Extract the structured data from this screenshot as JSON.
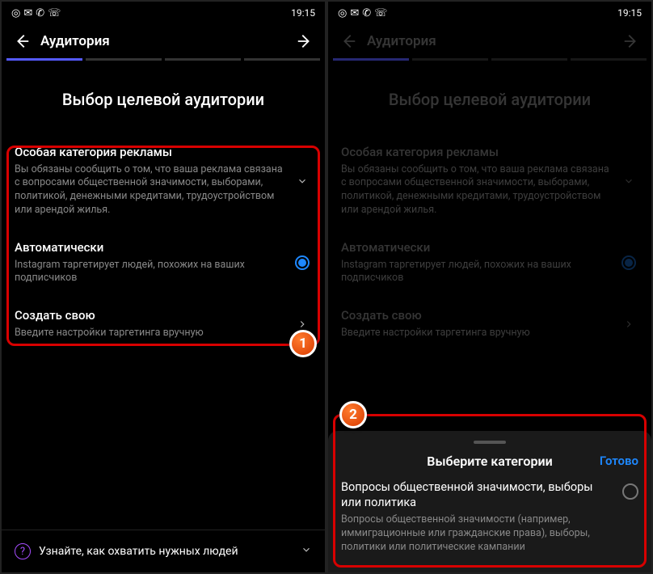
{
  "status": {
    "time": "19:15"
  },
  "nav": {
    "title": "Аудитория"
  },
  "heading": "Выбор целевой аудитории",
  "rows": {
    "special": {
      "title": "Особая категория рекламы",
      "sub": "Вы обязаны сообщить о том, что ваша реклама связана с вопросами общественной значимости, выборами, политикой, денежными кредитами, трудоустройством или арендой жилья."
    },
    "auto": {
      "title": "Автоматически",
      "sub": "Instagram таргетирует людей, похожих на ваших подписчиков"
    },
    "create": {
      "title": "Создать свою",
      "sub": "Введите настройки таргетинга вручную"
    }
  },
  "footer": {
    "tip": "Узнайте, как охватить нужных людей"
  },
  "sheet": {
    "title": "Выберите категории",
    "done": "Готово",
    "option": {
      "title": "Вопросы общественной значимости, выборы или политика",
      "sub": "Вопросы общественной значимости (например, иммиграционные или гражданские права), выборы, политики или политические кампании"
    }
  },
  "badges": {
    "one": "1",
    "two": "2"
  }
}
